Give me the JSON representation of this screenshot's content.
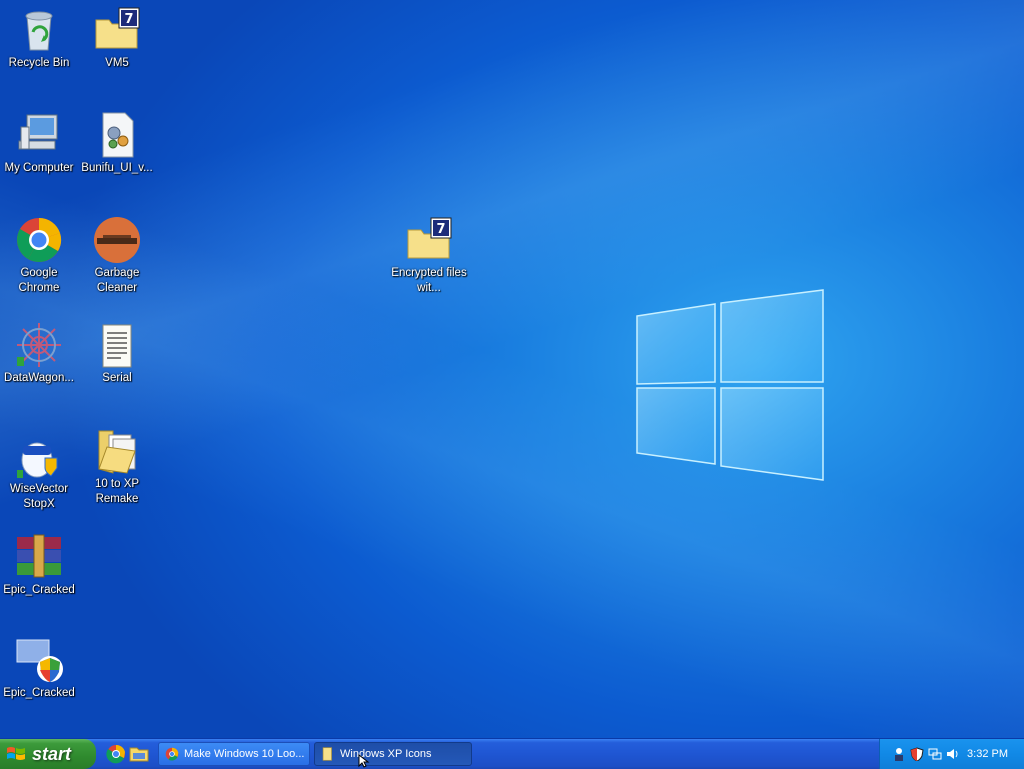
{
  "desktop": {
    "icons": [
      {
        "label": "Recycle Bin",
        "icon": "recycle-bin-icon"
      },
      {
        "label": "VM5",
        "icon": "folder-7zip-icon"
      },
      {
        "label": "My Computer",
        "icon": "my-computer-icon"
      },
      {
        "label": "Bunifu_UI_v...",
        "icon": "setup-file-icon"
      },
      {
        "label": "Google Chrome",
        "icon": "chrome-icon"
      },
      {
        "label": "Garbage Cleaner",
        "icon": "garbage-cleaner-icon"
      },
      {
        "label": "DataWagon...",
        "icon": "datawagon-icon"
      },
      {
        "label": "Serial",
        "icon": "text-document-icon"
      },
      {
        "label": "WiseVector StopX",
        "icon": "wisevector-icon"
      },
      {
        "label": "10 to XP Remake",
        "icon": "folder-documents-icon"
      },
      {
        "label": "Epic_Cracked",
        "icon": "winrar-archive-icon"
      },
      {
        "label": "Epic_Cracked",
        "icon": "shield-shortcut-icon"
      },
      {
        "label": "Encrypted files wit...",
        "icon": "folder-7zip-icon"
      }
    ]
  },
  "taskbar": {
    "start_label": "start",
    "quick_launch": [
      "chrome-icon",
      "folder-icon"
    ],
    "windows": [
      {
        "label": "Make Windows 10 Loo...",
        "icon": "chrome-icon",
        "active": false
      },
      {
        "label": "Windows XP Icons",
        "icon": "folder-icon",
        "active": true
      }
    ],
    "tray_icons": [
      "network-user-icon",
      "shield-icon",
      "network-icon",
      "volume-icon"
    ],
    "clock": "3:32 PM"
  },
  "colors": {
    "desktop_blue": "#0c5bd0",
    "taskbar_blue": "#245edb",
    "start_green": "#3c9a3b",
    "tray_blue": "#1189e6"
  }
}
